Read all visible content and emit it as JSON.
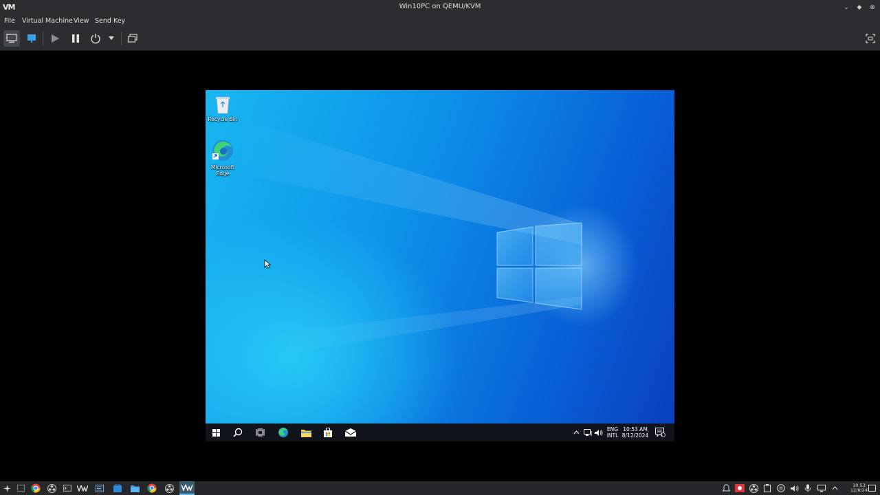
{
  "window": {
    "title": "Win10PC on QEMU/KVM",
    "app_logo": "VM"
  },
  "menu": {
    "file": "File",
    "virtual_machine": "Virtual Machine",
    "view": "View",
    "send_key": "Send Key"
  },
  "toolbar": {
    "icons": [
      "console-icon",
      "details-icon",
      "run-icon",
      "pause-icon",
      "power-icon",
      "chevron-down-icon",
      "snapshots-icon",
      "fullscreen-icon"
    ]
  },
  "guest": {
    "desktop_icons": {
      "recycle_bin": "Recycle Bin",
      "edge_line1": "Microsoft",
      "edge_line2": "Edge"
    },
    "taskbar": {
      "lang_line1": "ENG",
      "lang_line2": "INTL",
      "time": "10:53 AM",
      "date": "8/12/2024",
      "notification_count": "1"
    }
  },
  "host_taskbar": {
    "time": "10:53",
    "date": "12/8/24"
  },
  "colors": {
    "accent_active": "#5fb3e6",
    "desktop_blue": "#0d93ea"
  }
}
